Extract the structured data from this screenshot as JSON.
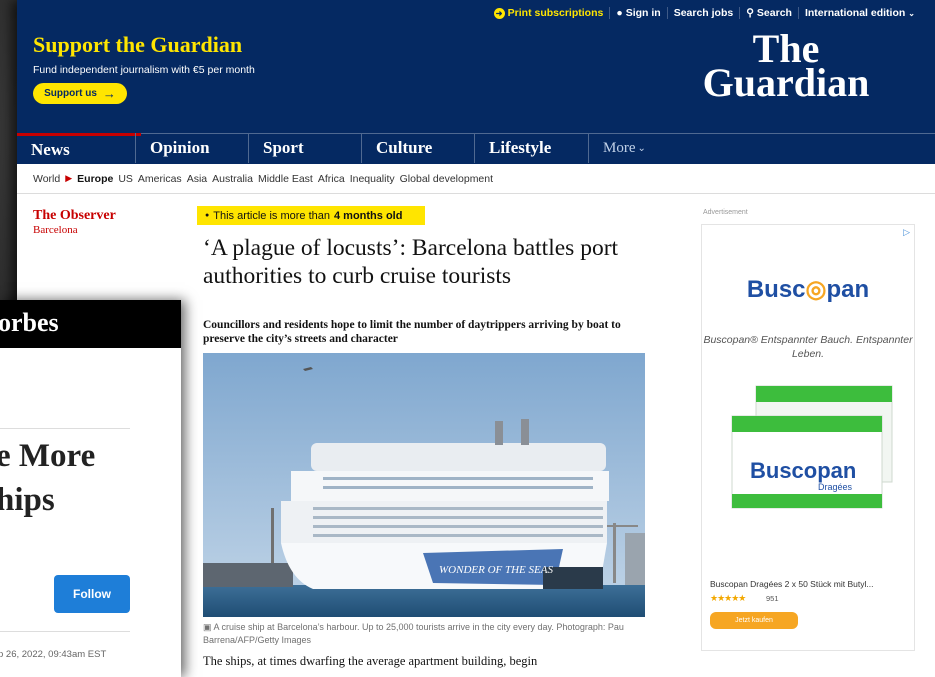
{
  "topbar": {
    "print": "Print subscriptions",
    "signin": "Sign in",
    "jobs": "Search jobs",
    "search": "Search",
    "edition": "International edition"
  },
  "support": {
    "heading": "Support the Guardian",
    "sub": "Fund independent journalism with €5 per month",
    "button": "Support us"
  },
  "logo": {
    "line1": "The",
    "line2": "Guardian"
  },
  "nav": [
    "News",
    "Opinion",
    "Sport",
    "Culture",
    "Lifestyle"
  ],
  "nav_more": "More",
  "subnav": {
    "world": "World",
    "current": "Europe",
    "items": [
      "US",
      "Americas",
      "Asia",
      "Australia",
      "Middle East",
      "Africa",
      "Inequality",
      "Global development"
    ]
  },
  "section": {
    "name": "The Observer",
    "sub": "Barcelona"
  },
  "age_notice": {
    "prefix": "This article is more than",
    "age": "4 months old"
  },
  "article": {
    "headline": "‘A plague of locusts’: Barcelona battles port authorities to curb cruise tourists",
    "standfirst": "Councillors and residents hope to limit the number of daytrippers arriving by boat to preserve the city’s streets and character",
    "caption": "A cruise ship at Barcelona’s harbour. Up to 25,000 tourists arrive in the city every day. Photograph: Pau Barrena/AFP/Getty Images",
    "body": "The ships, at times dwarfing the average apartment building, begin",
    "ship_name": "WONDER OF THE SEAS"
  },
  "ad": {
    "label": "Advertisement",
    "brand_a": "Busc",
    "brand_b": "pan",
    "tagline": "Buscopan® Entspannter Bauch. Entspannter Leben.",
    "box_brand": "Buscopan",
    "box_sub": "Dragées",
    "product": "Buscopan Dragées 2 x 50 Stück mit Butyl...",
    "stars": "★★★★★",
    "rating_count": "951",
    "cta": "Jetzt kaufen"
  },
  "forbes": {
    "brand": "orbes",
    "headline_l1": "e More",
    "headline_l2": "hips",
    "follow": "Follow",
    "date": "p 26, 2022, 09:43am EST"
  },
  "colors": {
    "guardian_blue": "#052962",
    "guardian_yellow": "#ffe500",
    "guardian_red": "#c70000",
    "forbes_follow": "#1e7ed8"
  }
}
